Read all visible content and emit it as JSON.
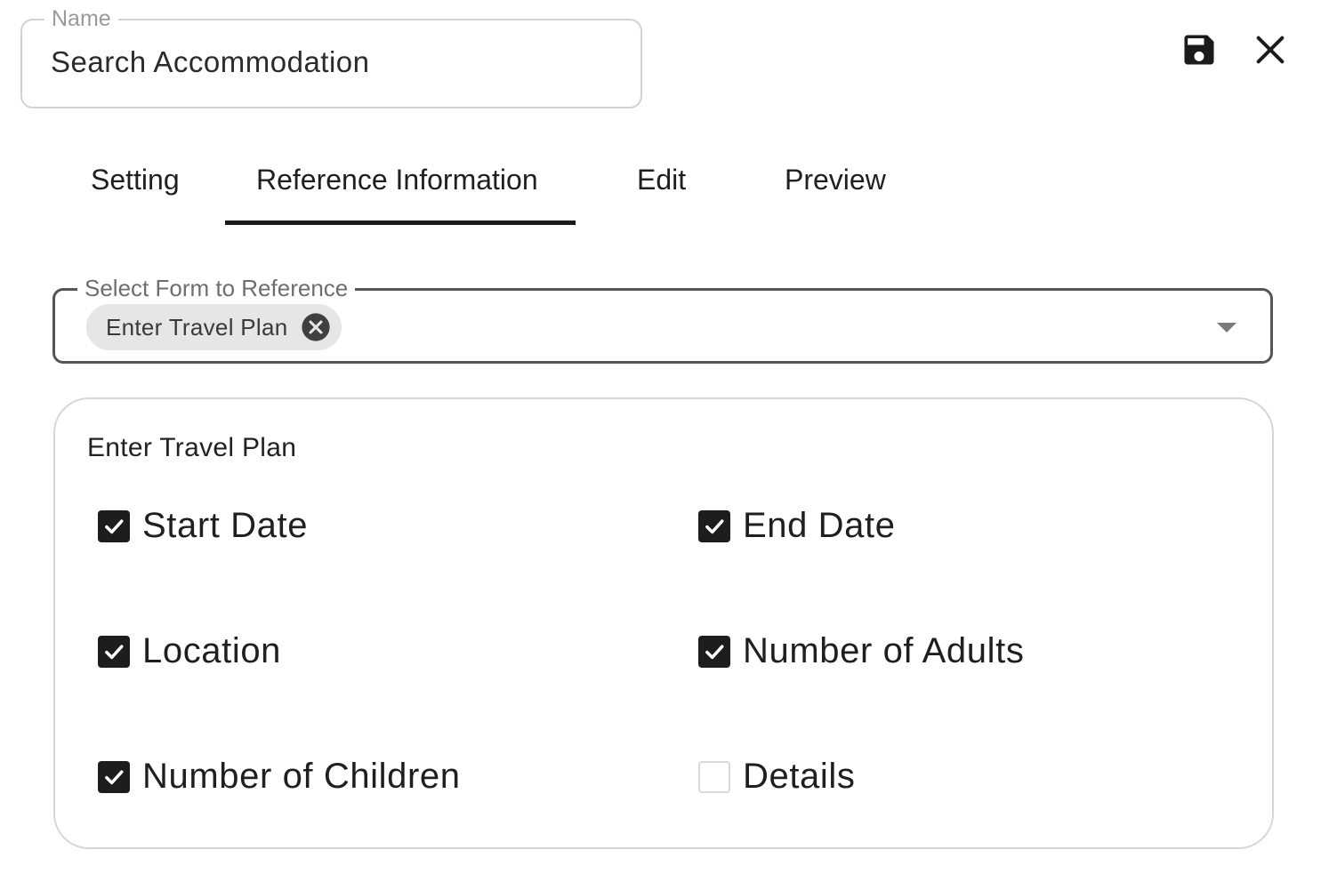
{
  "name_field": {
    "label": "Name",
    "value": "Search Accommodation"
  },
  "toolbar": {
    "save_icon": "save-icon",
    "close_icon": "close-icon"
  },
  "tabs": [
    {
      "label": "Setting",
      "active": false
    },
    {
      "label": "Reference Information",
      "active": true
    },
    {
      "label": "Edit",
      "active": false
    },
    {
      "label": "Preview",
      "active": false
    }
  ],
  "reference_select": {
    "label": "Select Form to Reference",
    "selected_chip": "Enter Travel Plan"
  },
  "fields_card": {
    "title": "Enter Travel Plan",
    "fields": [
      {
        "label": "Start Date",
        "checked": true
      },
      {
        "label": "End Date",
        "checked": true
      },
      {
        "label": "Location",
        "checked": true
      },
      {
        "label": "Number of Adults",
        "checked": true
      },
      {
        "label": "Number of Children",
        "checked": true
      },
      {
        "label": "Details",
        "checked": false
      }
    ]
  },
  "colors": {
    "accent": "#1b1b1b",
    "chip_bg": "#e6e6e6",
    "border_light": "#d2d2d2"
  }
}
